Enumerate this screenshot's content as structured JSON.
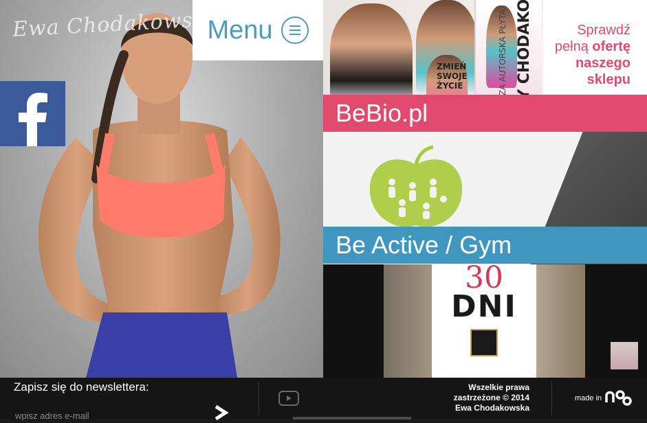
{
  "hero": {
    "signature": "Ewa Chodakowska",
    "brand_colors": {
      "facebook": "#3b5a9a",
      "top": "#ff7b6b",
      "shorts": "#3a3fa8"
    }
  },
  "menu": {
    "label": "Menu",
    "icon": "hamburger-circle-icon",
    "color": "#4a9bc1"
  },
  "tiles": {
    "bebio": {
      "title": "BeBio.pl",
      "promo_line1": "Sprawdź",
      "promo_line2a": "pełną ",
      "promo_line2b": "ofertę",
      "promo_line3": "naszego",
      "promo_line4": "sklepu",
      "dvd_title": "EWY CHODAKOWSKIEJ",
      "dvd_subtitle": "PIERWSZA AUTORSKA PŁYTA",
      "dvd_tag": "ZMIEŃ SWOJE ŻYCIE",
      "color": "#e04a6d"
    },
    "gym": {
      "title": "Be Active / Gym",
      "color": "#3f97c0"
    },
    "thirty": {
      "number": "30",
      "word": "DNI"
    }
  },
  "footer": {
    "newsletter_label": "Zapisz się do newslettera:",
    "email_placeholder": "wpisz adres e-mail",
    "copyright_line1": "Wszelkie prawa",
    "copyright_line2": "zastrzeżone © 2014",
    "copyright_line3": "Ewa Chodakowska",
    "made_in": "made in"
  }
}
